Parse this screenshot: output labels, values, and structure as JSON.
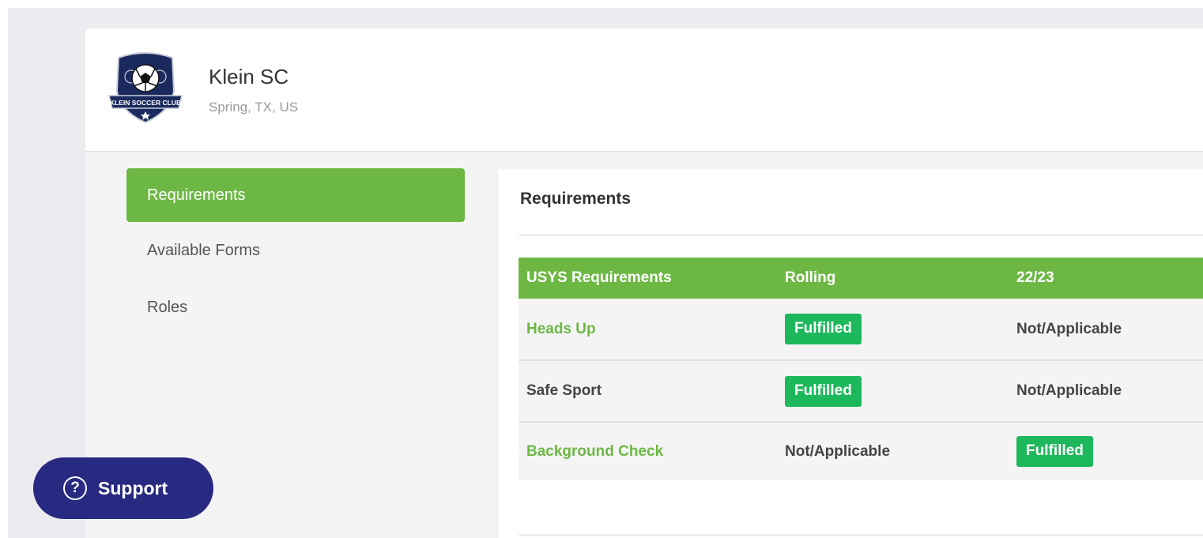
{
  "club": {
    "name": "Klein SC",
    "location": "Spring, TX, US",
    "logo_icon": "klein-soccer-club-crest",
    "logo_text": "KLEIN SOCCER CLUB"
  },
  "sidebar": {
    "items": [
      {
        "label": "Requirements",
        "active": true
      },
      {
        "label": "Available Forms",
        "active": false
      },
      {
        "label": "Roles",
        "active": false
      }
    ]
  },
  "panel": {
    "title": "Requirements"
  },
  "table": {
    "headers": [
      "USYS Requirements",
      "Rolling",
      "22/23"
    ],
    "rows": [
      {
        "name": "Heads Up",
        "rolling": "Fulfilled",
        "season": "Not/Applicable"
      },
      {
        "name": "Safe Sport",
        "rolling": "Fulfilled",
        "season": "Not/Applicable"
      },
      {
        "name": "Background Check",
        "rolling": "Not/Applicable",
        "season": "Fulfilled"
      }
    ]
  },
  "support": {
    "label": "Support",
    "icon": "question-circle-icon",
    "glyph": "?"
  },
  "colors": {
    "accent_green": "#6db844",
    "badge_green": "#1db85c",
    "support_navy": "#272a80"
  }
}
